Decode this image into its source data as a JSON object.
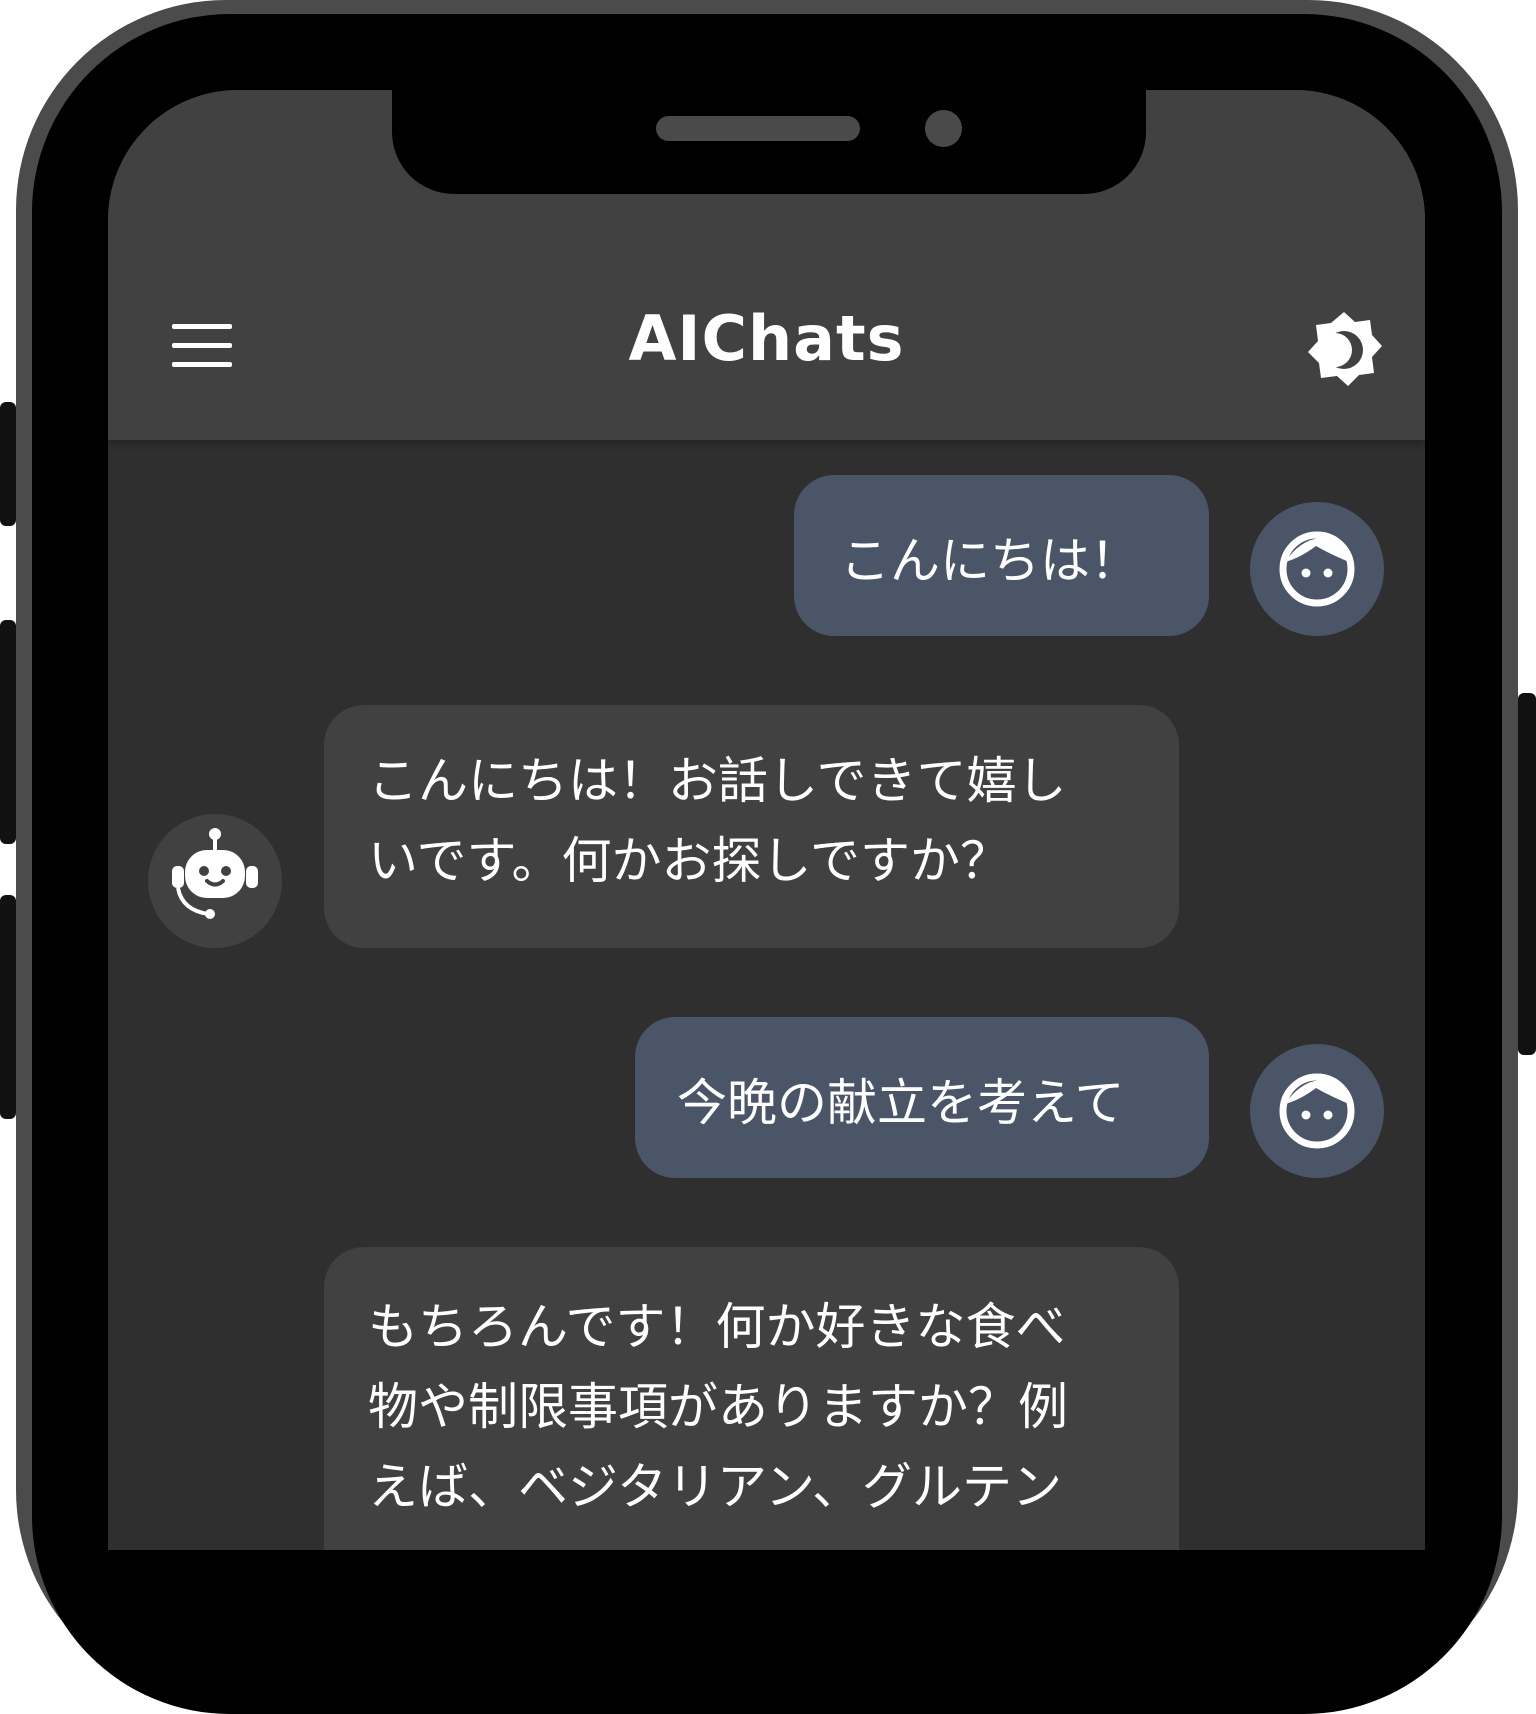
{
  "app": {
    "title": "AIChats"
  },
  "header": {
    "menu_icon": "hamburger-menu-icon",
    "theme_icon": "brightness-toggle-icon"
  },
  "messages": [
    {
      "sender": "user",
      "text": "こんにちは！",
      "avatar_icon": "user-face-icon"
    },
    {
      "sender": "bot",
      "lines": [
        "こんにちは！お話しできて嬉し",
        "いです。何かお探しですか？"
      ],
      "avatar_icon": "robot-assistant-icon"
    },
    {
      "sender": "user",
      "text": "今晩の献立を考えて",
      "avatar_icon": "user-face-icon"
    },
    {
      "sender": "bot",
      "lines": [
        "もちろんです！何か好きな食べ",
        "物や制限事項がありますか？例",
        "えば、ベジタリアン、グルテン"
      ]
    }
  ],
  "colors": {
    "screen_bg": "#2f2f2f",
    "header_bg": "#414141",
    "user_bubble": "#4a5568",
    "bot_bubble": "#414141",
    "text": "#ffffff"
  }
}
